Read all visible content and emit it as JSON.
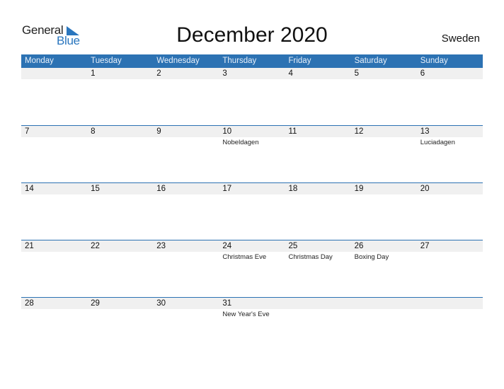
{
  "logo": {
    "word1": "General",
    "word2": "Blue"
  },
  "title": "December 2020",
  "country": "Sweden",
  "colors": {
    "accent": "#2c72b3",
    "logo_blue": "#2a76be",
    "strip": "#f0f0f0"
  },
  "weekdays": [
    "Monday",
    "Tuesday",
    "Wednesday",
    "Thursday",
    "Friday",
    "Saturday",
    "Sunday"
  ],
  "weeks": [
    [
      {
        "day": "",
        "holiday": ""
      },
      {
        "day": "1",
        "holiday": ""
      },
      {
        "day": "2",
        "holiday": ""
      },
      {
        "day": "3",
        "holiday": ""
      },
      {
        "day": "4",
        "holiday": ""
      },
      {
        "day": "5",
        "holiday": ""
      },
      {
        "day": "6",
        "holiday": ""
      }
    ],
    [
      {
        "day": "7",
        "holiday": ""
      },
      {
        "day": "8",
        "holiday": ""
      },
      {
        "day": "9",
        "holiday": ""
      },
      {
        "day": "10",
        "holiday": "Nobeldagen"
      },
      {
        "day": "11",
        "holiday": ""
      },
      {
        "day": "12",
        "holiday": ""
      },
      {
        "day": "13",
        "holiday": "Luciadagen"
      }
    ],
    [
      {
        "day": "14",
        "holiday": ""
      },
      {
        "day": "15",
        "holiday": ""
      },
      {
        "day": "16",
        "holiday": ""
      },
      {
        "day": "17",
        "holiday": ""
      },
      {
        "day": "18",
        "holiday": ""
      },
      {
        "day": "19",
        "holiday": ""
      },
      {
        "day": "20",
        "holiday": ""
      }
    ],
    [
      {
        "day": "21",
        "holiday": ""
      },
      {
        "day": "22",
        "holiday": ""
      },
      {
        "day": "23",
        "holiday": ""
      },
      {
        "day": "24",
        "holiday": "Christmas Eve"
      },
      {
        "day": "25",
        "holiday": "Christmas Day"
      },
      {
        "day": "26",
        "holiday": "Boxing Day"
      },
      {
        "day": "27",
        "holiday": ""
      }
    ],
    [
      {
        "day": "28",
        "holiday": ""
      },
      {
        "day": "29",
        "holiday": ""
      },
      {
        "day": "30",
        "holiday": ""
      },
      {
        "day": "31",
        "holiday": "New Year's Eve"
      },
      {
        "day": "",
        "holiday": ""
      },
      {
        "day": "",
        "holiday": ""
      },
      {
        "day": "",
        "holiday": ""
      }
    ]
  ]
}
